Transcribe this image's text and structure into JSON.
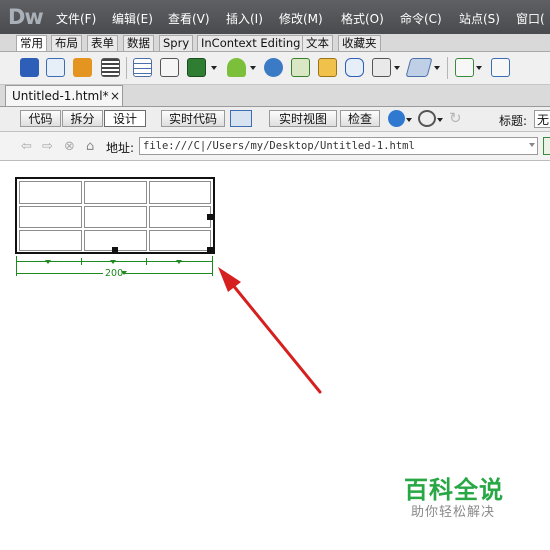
{
  "app": {
    "logo": "Dw"
  },
  "menu": [
    "文件(F)",
    "编辑(E)",
    "查看(V)",
    "插入(I)",
    "修改(M)",
    "格式(O)",
    "命令(C)",
    "站点(S)",
    "窗口("
  ],
  "insert_tabs": [
    "常用",
    "布局",
    "表单",
    "数据",
    "Spry",
    "InContext Editing",
    "文本",
    "收藏夹"
  ],
  "insert_tab_active": "常用",
  "toolbar_icons": [
    "hyperlink-icon",
    "email-link-icon",
    "named-anchor-icon",
    "horizontal-rule-icon",
    "table-icon",
    "insert-div-icon",
    "image-icon",
    "media-icon",
    "date-icon",
    "server-side-include-icon",
    "comment-icon",
    "head-icon",
    "script-icon",
    "templates-icon",
    "tag-chooser-icon"
  ],
  "document": {
    "tab_title": "Untitled-1.html*",
    "close": "×"
  },
  "view_buttons": {
    "code": "代码",
    "split": "拆分",
    "design": "设计",
    "live_code": "实时代码",
    "live_view": "实时视图",
    "inspect": "检查"
  },
  "title_label": "标题:",
  "title_value": "无",
  "address": {
    "label": "地址:",
    "value": "file:///C|/Users/my/Desktop/Untitled-1.html"
  },
  "table": {
    "rows": 3,
    "cols": 3,
    "width_label": "200"
  },
  "colors": {
    "menubar": "#4f5054",
    "table_guides": "#1d8a1d",
    "arrow": "#d62020",
    "watermark": "#28a745"
  },
  "watermark": {
    "title": "百科全说",
    "subtitle": "助你轻松解决"
  }
}
